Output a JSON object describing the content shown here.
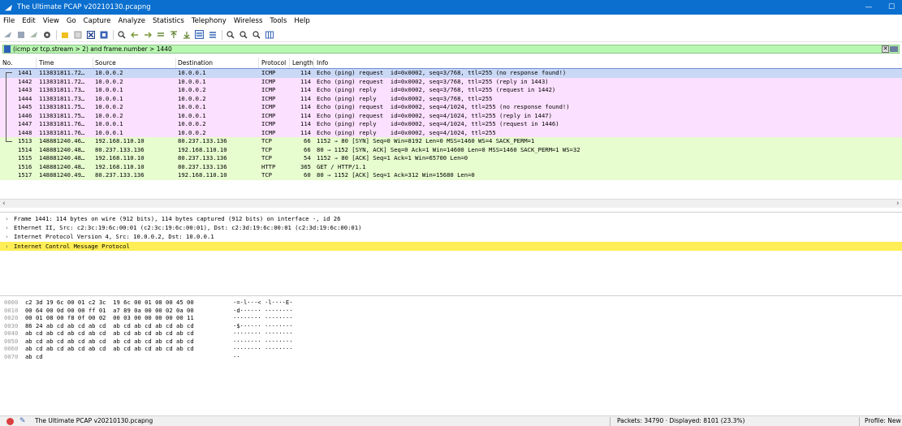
{
  "window": {
    "title": "The Ultimate PCAP v20210130.pcapng",
    "minimize": "—",
    "maximize": "☐"
  },
  "menu": [
    "File",
    "Edit",
    "View",
    "Go",
    "Capture",
    "Analyze",
    "Statistics",
    "Telephony",
    "Wireless",
    "Tools",
    "Help"
  ],
  "toolbar": {
    "icons": [
      "shark-fin-start-icon",
      "stop-icon",
      "restart-icon",
      "options-gear-icon",
      "open-folder-icon",
      "save-icon",
      "close-file-icon",
      "reload-icon",
      "find-packet-icon",
      "go-back-icon",
      "go-forward-icon",
      "go-to-packet-icon",
      "first-packet-icon",
      "last-packet-icon",
      "autoscroll-icon",
      "colorize-icon",
      "zoom-in-icon",
      "zoom-out-icon",
      "normal-size-icon",
      "resize-columns-icon"
    ]
  },
  "filter": {
    "value": "(icmp or tcp.stream > 2) and frame.number > 1440"
  },
  "columns": {
    "no": "No.",
    "time": "Time",
    "source": "Source",
    "destination": "Destination",
    "protocol": "Protocol",
    "length": "Length",
    "info": "Info"
  },
  "packets": [
    {
      "no": "1441",
      "time": "113831811.72…",
      "src": "10.0.0.2",
      "dst": "10.0.0.1",
      "proto": "ICMP",
      "len": "114",
      "info": "Echo (ping) request  id=0x0002, seq=3/768, ttl=255 (no response found!)"
    },
    {
      "no": "1442",
      "time": "113831811.72…",
      "src": "10.0.0.2",
      "dst": "10.0.0.1",
      "proto": "ICMP",
      "len": "114",
      "info": "Echo (ping) request  id=0x0002, seq=3/768, ttl=255 (reply in 1443)"
    },
    {
      "no": "1443",
      "time": "113831811.73…",
      "src": "10.0.0.1",
      "dst": "10.0.0.2",
      "proto": "ICMP",
      "len": "114",
      "info": "Echo (ping) reply    id=0x0002, seq=3/768, ttl=255 (request in 1442)"
    },
    {
      "no": "1444",
      "time": "113831811.73…",
      "src": "10.0.0.1",
      "dst": "10.0.0.2",
      "proto": "ICMP",
      "len": "114",
      "info": "Echo (ping) reply    id=0x0002, seq=3/768, ttl=255"
    },
    {
      "no": "1445",
      "time": "113831811.75…",
      "src": "10.0.0.2",
      "dst": "10.0.0.1",
      "proto": "ICMP",
      "len": "114",
      "info": "Echo (ping) request  id=0x0002, seq=4/1024, ttl=255 (no response found!)"
    },
    {
      "no": "1446",
      "time": "113831811.75…",
      "src": "10.0.0.2",
      "dst": "10.0.0.1",
      "proto": "ICMP",
      "len": "114",
      "info": "Echo (ping) request  id=0x0002, seq=4/1024, ttl=255 (reply in 1447)"
    },
    {
      "no": "1447",
      "time": "113831811.76…",
      "src": "10.0.0.1",
      "dst": "10.0.0.2",
      "proto": "ICMP",
      "len": "114",
      "info": "Echo (ping) reply    id=0x0002, seq=4/1024, ttl=255 (request in 1446)"
    },
    {
      "no": "1448",
      "time": "113831811.76…",
      "src": "10.0.0.1",
      "dst": "10.0.0.2",
      "proto": "ICMP",
      "len": "114",
      "info": "Echo (ping) reply    id=0x0002, seq=4/1024, ttl=255"
    },
    {
      "no": "1513",
      "time": "148881240.46…",
      "src": "192.168.110.10",
      "dst": "80.237.133.136",
      "proto": "TCP",
      "len": "66",
      "info": "1152 → 80 [SYN] Seq=0 Win=8192 Len=0 MSS=1460 WS=4 SACK_PERM=1"
    },
    {
      "no": "1514",
      "time": "148881240.48…",
      "src": "80.237.133.136",
      "dst": "192.168.110.10",
      "proto": "TCP",
      "len": "66",
      "info": "80 → 1152 [SYN, ACK] Seq=0 Ack=1 Win=14600 Len=0 MSS=1460 SACK_PERM=1 WS=32"
    },
    {
      "no": "1515",
      "time": "148881240.48…",
      "src": "192.168.110.10",
      "dst": "80.237.133.136",
      "proto": "TCP",
      "len": "54",
      "info": "1152 → 80 [ACK] Seq=1 Ack=1 Win=65700 Len=0"
    },
    {
      "no": "1516",
      "time": "148881240.48…",
      "src": "192.168.110.10",
      "dst": "80.237.133.136",
      "proto": "HTTP",
      "len": "365",
      "info": "GET / HTTP/1.1"
    },
    {
      "no": "1517",
      "time": "148881240.49…",
      "src": "80.237.133.136",
      "dst": "192.168.110.10",
      "proto": "TCP",
      "len": "60",
      "info": "80 → 1152 [ACK] Seq=1 Ack=312 Win=15680 Len=0"
    }
  ],
  "details": [
    "Frame 1441: 114 bytes on wire (912 bits), 114 bytes captured (912 bits) on interface -, id 26",
    "Ethernet II, Src: c2:3c:19:6c:00:01 (c2:3c:19:6c:00:01), Dst: c2:3d:19:6c:00:01 (c2:3d:19:6c:00:01)",
    "Internet Protocol Version 4, Src: 10.0.0.2, Dst: 10.0.0.1",
    "Internet Control Message Protocol"
  ],
  "hex": [
    {
      "off": "0000",
      "bytes": "c2 3d 19 6c 00 01 c2 3c  19 6c 00 01 08 00 45 00",
      "ascii": "·=·l···< ·l····E·"
    },
    {
      "off": "0010",
      "bytes": "00 64 00 0d 00 00 ff 01  a7 89 0a 00 00 02 0a 00",
      "ascii": "·d······ ········"
    },
    {
      "off": "0020",
      "bytes": "00 01 08 00 f8 0f 00 02  00 03 00 00 00 00 00 11",
      "ascii": "········ ········"
    },
    {
      "off": "0030",
      "bytes": "86 24 ab cd ab cd ab cd  ab cd ab cd ab cd ab cd",
      "ascii": "·$······ ········"
    },
    {
      "off": "0040",
      "bytes": "ab cd ab cd ab cd ab cd  ab cd ab cd ab cd ab cd",
      "ascii": "········ ········"
    },
    {
      "off": "0050",
      "bytes": "ab cd ab cd ab cd ab cd  ab cd ab cd ab cd ab cd",
      "ascii": "········ ········"
    },
    {
      "off": "0060",
      "bytes": "ab cd ab cd ab cd ab cd  ab cd ab cd ab cd ab cd",
      "ascii": "········ ········"
    },
    {
      "off": "0070",
      "bytes": "ab cd",
      "ascii": "··"
    }
  ],
  "status": {
    "file": "The Ultimate PCAP v20210130.pcapng",
    "stats": "Packets: 34790 · Displayed: 8101 (23.3%)",
    "profile": "Profile: New ("
  },
  "colors": {
    "titlebar": "#0a6fcf",
    "filter_valid": "#b8f7b0",
    "icmp_row": "#fce0ff",
    "tcp_row": "#e7fccf",
    "selected_row": "#c9d8f5",
    "highlight_detail": "#ffee55"
  }
}
